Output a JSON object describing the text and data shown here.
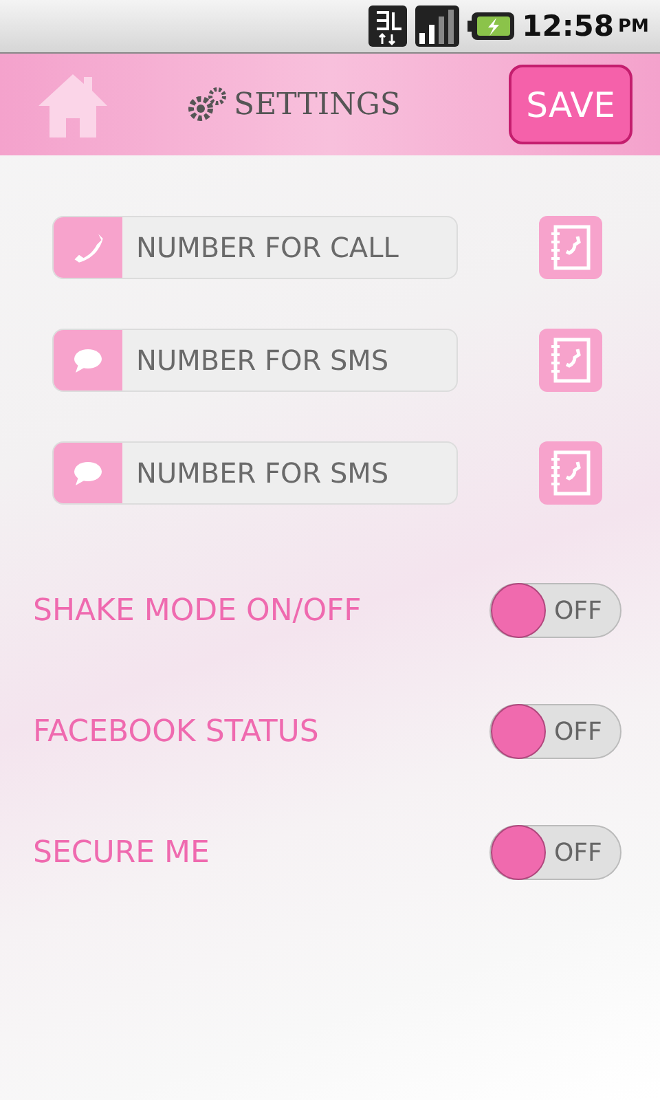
{
  "status_bar": {
    "time": "12:58",
    "ampm": "PM"
  },
  "header": {
    "title": "SETTINGS",
    "save": "SAVE"
  },
  "fields": [
    {
      "kind": "phone",
      "placeholder": "NUMBER FOR CALL"
    },
    {
      "kind": "message",
      "placeholder": "NUMBER FOR SMS"
    },
    {
      "kind": "message",
      "placeholder": "NUMBER FOR SMS"
    }
  ],
  "toggles": [
    {
      "label": "SHAKE MODE ON/OFF",
      "on": false,
      "state_text": "OFF"
    },
    {
      "label": "FACEBOOK STATUS",
      "on": false,
      "state_text": "OFF"
    },
    {
      "label": "SECURE ME",
      "on": false,
      "state_text": "OFF"
    }
  ]
}
